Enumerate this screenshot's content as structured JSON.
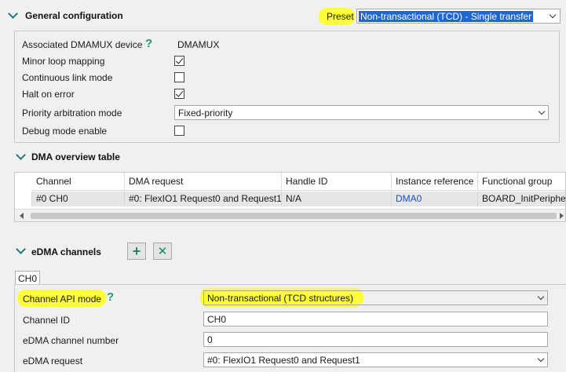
{
  "general": {
    "title": "General configuration",
    "preset_label": "Preset",
    "preset_value": "Non-transactional (TCD) - Single transfer",
    "fields": {
      "dmamux_label": "Associated DMAMUX device",
      "dmamux_value": "DMAMUX",
      "minor_loop_label": "Minor loop mapping",
      "minor_loop_checked": true,
      "continuous_link_label": "Continuous link mode",
      "continuous_link_checked": false,
      "halt_label": "Halt on error",
      "halt_checked": true,
      "priority_label": "Priority arbitration mode",
      "priority_value": "Fixed-priority",
      "debug_label": "Debug mode enable",
      "debug_checked": false
    }
  },
  "overview": {
    "title": "DMA overview table",
    "columns": [
      "Channel",
      "DMA request",
      "Handle ID",
      "Instance reference",
      "Functional group"
    ],
    "rows": [
      [
        "#0 CH0",
        "#0: FlexIO1 Request0 and Request1",
        "N/A",
        "DMA0",
        "BOARD_InitPeripherals"
      ]
    ]
  },
  "edma": {
    "title": "eDMA channels",
    "add_icon": "plus-icon",
    "remove_icon": "x-icon",
    "tab_label": "CH0",
    "api_mode_label": "Channel API mode",
    "api_mode_value": "Non-transactional (TCD structures)",
    "channel_id_label": "Channel ID",
    "channel_id_value": "CH0",
    "channel_number_label": "eDMA channel number",
    "channel_number_value": "0",
    "request_label": "eDMA request",
    "request_value": "#0: FlexIO1 Request0 and Request1"
  },
  "colors": {
    "highlight": "#fdfd3a",
    "accent_green": "#1e9a6e",
    "selection_blue": "#1e66d0",
    "link_blue": "#1c4fbf"
  }
}
